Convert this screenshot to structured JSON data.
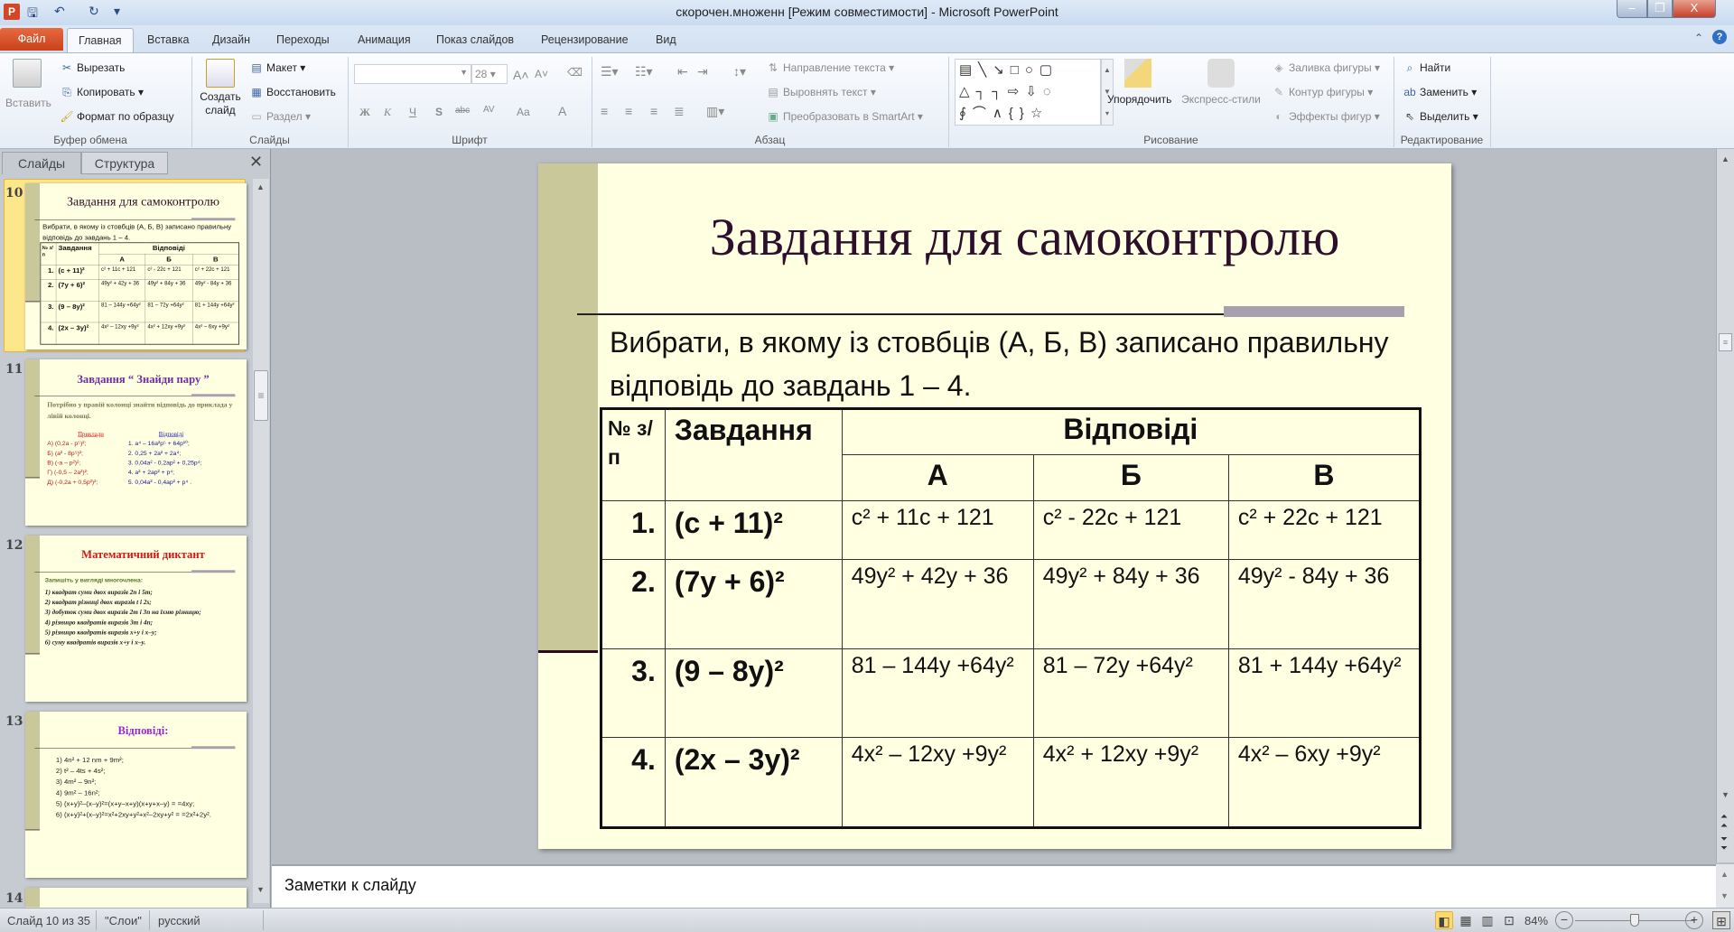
{
  "window": {
    "title": "скорочен.множенн [Режим совместимости]  -  Microsoft PowerPoint",
    "minimize": "–",
    "restore": "❐",
    "close": "X"
  },
  "ribbon_tabs": [
    "Главная",
    "Вставка",
    "Дизайн",
    "Переходы",
    "Анимация",
    "Показ слайдов",
    "Рецензирование",
    "Вид"
  ],
  "file_tab": "Файл",
  "ribbon": {
    "clipboard": {
      "label": "Буфер обмена",
      "paste": "Вставить",
      "cut": "Вырезать",
      "copy": "Копировать",
      "format": "Формат по образцу"
    },
    "slides": {
      "label": "Слайды",
      "new_slide": "Создать слайд",
      "layout": "Макет",
      "reset": "Восстановить",
      "section": "Раздел"
    },
    "font": {
      "label": "Шрифт",
      "font_name": "",
      "font_size": "28",
      "bold": "Ж",
      "italic": "К",
      "underline": "Ч",
      "shadow": "S",
      "strike": "abc",
      "spacing": "AV",
      "case": "Aa",
      "color": "A",
      "grow": "A˄",
      "shrink": "A˅"
    },
    "paragraph": {
      "label": "Абзац",
      "direction": "Направление текста",
      "align_text": "Выровнять текст",
      "smartart": "Преобразовать в SmartArt"
    },
    "drawing": {
      "label": "Рисование",
      "arrange": "Упорядочить",
      "quick_styles": "Экспресс-стили",
      "fill": "Заливка фигуры",
      "outline": "Контур фигуры",
      "effects": "Эффекты фигур"
    },
    "editing": {
      "label": "Редактирование",
      "find": "Найти",
      "replace": "Заменить",
      "select": "Выделить"
    }
  },
  "pane": {
    "tab_slides": "Слайды",
    "tab_outline": "Структура",
    "close": "✕"
  },
  "slide10": {
    "number": "10",
    "title": "Завдання для самоконтролю",
    "subtitle": "Вибрати, в якому із стовбців (А, Б, В) записано правильну відповідь до завдань 1 – 4.",
    "header": {
      "num": "№ з/п",
      "task": "Завдання",
      "answers": "Відповіді",
      "cols": [
        "А",
        "Б",
        "В"
      ]
    },
    "rows": [
      {
        "n": "1.",
        "task": "(c + 11)²",
        "a": "c² + 11c + 121",
        "b": "c² - 22c + 121",
        "c": "c² + 22c + 121"
      },
      {
        "n": "2.",
        "task": "(7y + 6)²",
        "a": "49y² + 42y + 36",
        "b": "49y² + 84y + 36",
        "c": "49y² - 84y + 36"
      },
      {
        "n": "3.",
        "task": "(9 – 8y)²",
        "a": "81 – 144y +64y²",
        "b": "81 – 72y +64y²",
        "c": "81 + 144y +64y²"
      },
      {
        "n": "4.",
        "task": "(2x – 3y)²",
        "a": "4x² – 12xy +9y²",
        "b": "4x² + 12xy +9y²",
        "c": "4x² – 6xy +9y²"
      }
    ]
  },
  "slide11": {
    "number": "11",
    "title": "Завдання  “ Знайди пару ”",
    "subtitle": "Потрібно у правій колонці знайти відповідь до приклада у лівій колонці.",
    "left_head": "Приклади",
    "right_head": "Відповіді",
    "left": [
      "А)  (0,2a - p⁵)²;",
      "Б)  (a² - 8p⁵)²;",
      "В)  (-a – p²)²;",
      "Г)  (-0,5 – 2a²)²;",
      "Д)  (-0,2a + 0,5p²)²;"
    ],
    "right": [
      "1.  a⁴ – 16a²p⁵ + 64p¹⁰;",
      "2.  0,25 + 2a² + 2a⁴;",
      "3.  0,04a² - 0,2ap² + 0,25p⁴;",
      "4.  a² + 2ap² + p⁴;",
      "5.  0,04a² - 0,4ap² + p⁴ ."
    ]
  },
  "slide12": {
    "number": "12",
    "title": "Математичний диктант",
    "subtitle": "Запишіть у вигляді многочлена:",
    "items": [
      "1) квадрат суми двох виразів 2n і 5m;",
      "2) квадрат різниці двох виразів t і 2s;",
      "3) добуток суми двох виразів 2m і 3n на їхню різницю;",
      "4) різницю квадратів виразів 3m і 4n;",
      "5) різницю квадратів виразів x+y і x–y;",
      "6) суму квадратів виразів x+y і x–y."
    ]
  },
  "slide13": {
    "number": "13",
    "title": "Відповіді:",
    "items": [
      "1)  4n² + 12 nm + 9m²;",
      "2)  t² – 4ts + 4s²;",
      "3)  4m² – 9n²;",
      "4)  9m² – 16n²;",
      "5)  (x+y)²–(x–y)²=(x+y–x+y)(x+y+x–y) = =4xy;",
      "6)  (x+y)²+(x–y)²=x²+2xy+y²+x²–2xy+y² = =2x²+2y²."
    ]
  },
  "slide14": {
    "number": "14"
  },
  "notes": {
    "placeholder": "Заметки к слайду"
  },
  "status": {
    "slide": "Слайд 10 из 35",
    "theme": "\"Слои\"",
    "language": "русский",
    "zoom": "84%",
    "zoom_percent": 84
  }
}
